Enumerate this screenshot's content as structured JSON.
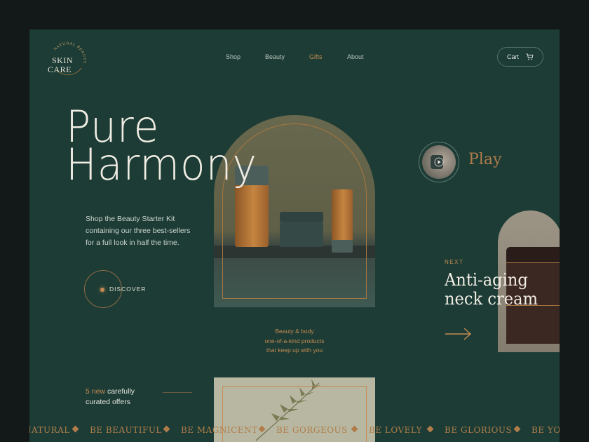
{
  "logo": {
    "word_top": "SKIN",
    "word_bottom": "CARE",
    "ring_text": "NATURAL BEAUTY"
  },
  "nav": {
    "items": [
      {
        "label": "Shop"
      },
      {
        "label": "Beauty"
      },
      {
        "label": "Gifts",
        "active": true
      },
      {
        "label": "About"
      }
    ],
    "cart_label": "Cart"
  },
  "hero": {
    "title_line1": "Pure",
    "title_line2": "Harmony",
    "desc_line1": "Shop the Beauty Starter Kit",
    "desc_line2": "containing our three best-sellers",
    "desc_line3": "for a full look in half the time.",
    "discover_label": "DISCOVER"
  },
  "showcase": {
    "tag_line1": "Beauty & body",
    "tag_line2": "one-of-a-kind products",
    "tag_line3": "that keep up with you"
  },
  "offers": {
    "count_text": "5 new",
    "text_1": "carefully",
    "text_2": "curated offers"
  },
  "play": {
    "label": "Play"
  },
  "next": {
    "label": "NEXT",
    "title_line1": "Anti-aging",
    "title_line2": "neck cream"
  },
  "marquee": [
    "NATURAL",
    "BE BEAUTIFUL",
    "BE MAGNICENT",
    "BE GORGEOUS",
    "BE LOVELY",
    "BE GLORIOUS",
    "BE YOU"
  ],
  "colors": {
    "background": "#1c3c35",
    "accent": "#c58b52",
    "text": "#f1ede4",
    "frame": "#121918"
  },
  "icons": {
    "cart": "cart-icon",
    "play": "play-icon",
    "arrow": "arrow-right-icon",
    "diamond": "diamond-icon"
  }
}
